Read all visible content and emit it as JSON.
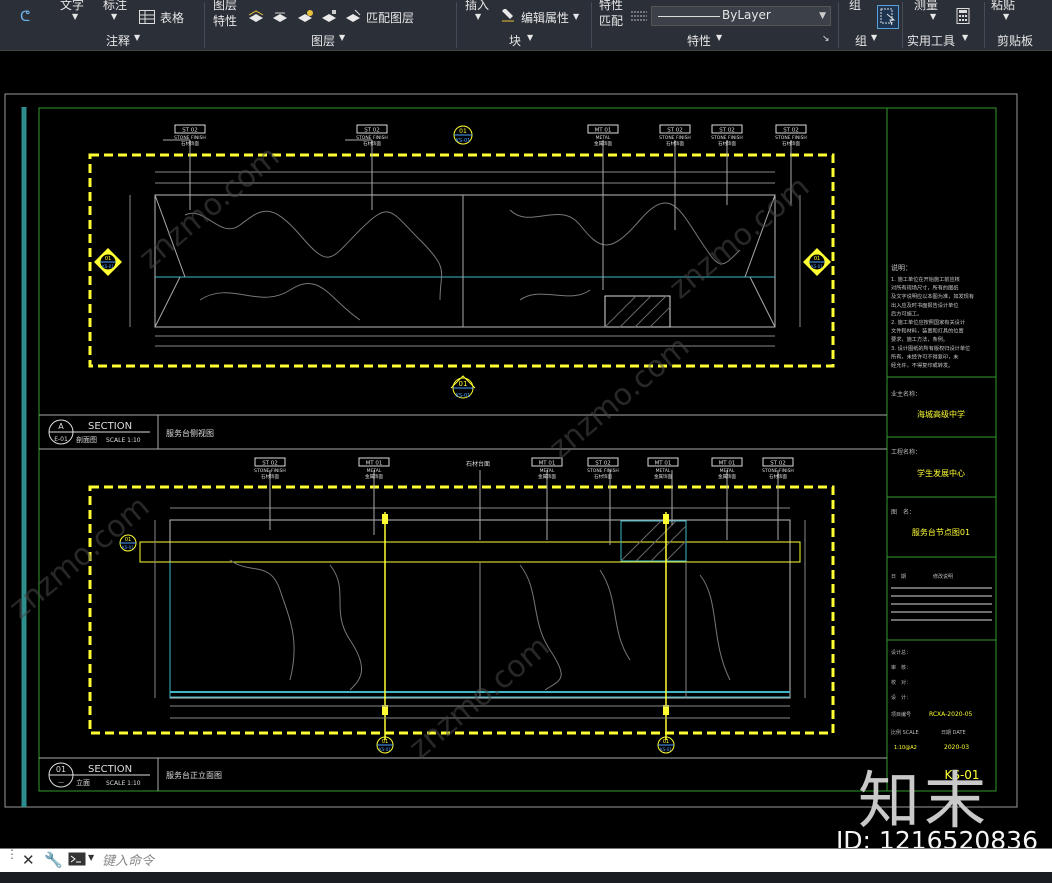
{
  "ribbon": {
    "text_label": "文字",
    "dimension_label": "标注",
    "table_label": "表格",
    "annotation_panel": "注释",
    "layer_props_line1": "图层",
    "layer_props_line2": "特性",
    "match_layer_label": "匹配图层",
    "layers_panel": "图层",
    "insert_label": "插入",
    "edit_attr_label": "编辑属性",
    "block_panel": "块",
    "match_props_line1": "特性",
    "match_props_line2": "匹配",
    "bylayer_value": "ByLayer",
    "properties_panel": "特性",
    "group_label": "组",
    "group_panel": "组",
    "measure_label": "测量",
    "utilities_panel": "实用工具",
    "paste_label": "粘贴",
    "clipboard_panel": "剪贴板"
  },
  "drawing": {
    "top_section": {
      "badge_top": "A",
      "badge_bottom": "E-01",
      "title": "SECTION",
      "subtitle": "剖面图",
      "scale": "SCALE  1:10",
      "name": "服务台侧视图",
      "tags": [
        {
          "code": "ST  02",
          "caption": "STONE FINISH",
          "cn": "石材饰面"
        },
        {
          "code": "ST  02",
          "caption": "STONE FINISH",
          "cn": "石材饰面"
        },
        {
          "code": "MT  01",
          "caption": "METAL",
          "cn": "金属饰面"
        },
        {
          "code": "ST  02",
          "caption": "STONE FINISH",
          "cn": "石材饰面"
        },
        {
          "code": "ST  02",
          "caption": "STONE FINISH",
          "cn": "石材饰面"
        },
        {
          "code": "ST  02",
          "caption": "STONE FINISH",
          "cn": "石材饰面"
        }
      ]
    },
    "bottom_section": {
      "badge_top": "01",
      "badge_bottom": "—",
      "title": "SECTION",
      "subtitle": "立面",
      "scale": "SCALE  1:10",
      "name": "服务台正立面图",
      "stone_note": "石材台面",
      "tags": [
        {
          "code": "ST  02",
          "caption": "STONE FINISH",
          "cn": "石材饰面"
        },
        {
          "code": "MT  01",
          "caption": "METAL",
          "cn": "金属饰面"
        },
        {
          "code": "MT  01",
          "caption": "METAL",
          "cn": "金属饰面"
        },
        {
          "code": "ST  02",
          "caption": "STONE FINISH",
          "cn": "石材饰面"
        },
        {
          "code": "MT  01",
          "caption": "METAL",
          "cn": "金属饰面"
        },
        {
          "code": "MT  01",
          "caption": "METAL",
          "cn": "金属饰面"
        },
        {
          "code": "ST  02",
          "caption": "STONE FINISH",
          "cn": "石材饰面"
        }
      ]
    },
    "title_block": {
      "notes_header": "说明：",
      "notes": [
        "1. 施工单位在开始施工前应核",
        "对所有现场尺寸，所有的图纸",
        "及文字说明应以本图为准，如发现有",
        "出入应及时书面报告设计单位",
        "后方可施工。",
        "2. 施工单位应按照国家有关设计",
        "文件和材料，装置和灯具的位置",
        "要求，施工方法，条例。",
        "3. 设计图纸的所有版权归设计单位",
        "所有，未经许可不得复印，未",
        "经允许，不得复印或转发。"
      ],
      "client_label": "业主名称：",
      "client_value": "海城高级中学",
      "project_label": "工程名称：",
      "project_value": "学生发展中心",
      "drawing_label": "图　名：",
      "drawing_value": "服务台节点图01",
      "rev_label1": "日　期",
      "rev_label2": "修改说明",
      "staff": [
        "设计总：",
        "审　核：",
        "校　对：",
        "设　计："
      ],
      "proj_no_label": "项目编号",
      "proj_no_value": "RCXA-2020-05",
      "scale_label": "比例 SCALE",
      "date_label": "日期 DATE",
      "scale_value": "1:10@A2",
      "date_value": "2020-03",
      "sheet_no": "KS-01"
    },
    "badge_01": "01",
    "badge_sub": "KS-01"
  },
  "command": {
    "placeholder": "键入命令"
  },
  "watermark": {
    "site": "znzmo.com",
    "big": "知末",
    "id": "ID: 1216520836"
  },
  "colors": {
    "yellow_dash": "#ffff33",
    "green_frame": "#2f9a2f",
    "cyan_line": "#3fb7c6",
    "ribbon_bg": "#2b2f38"
  }
}
